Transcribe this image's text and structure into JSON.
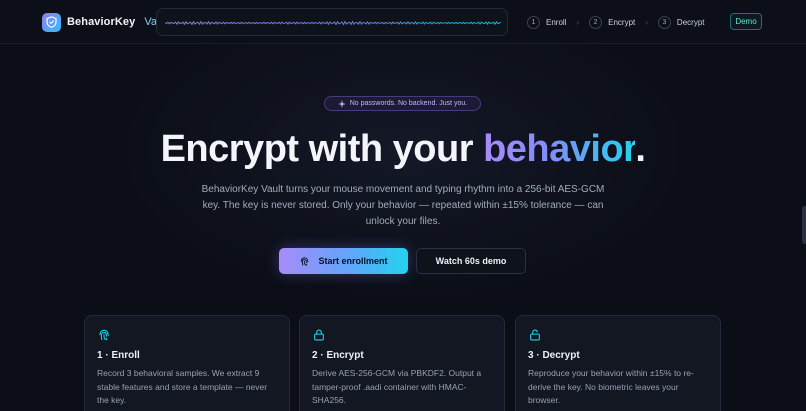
{
  "brand": {
    "name": "BehaviorKey",
    "accent": "Vault"
  },
  "steps": [
    {
      "num": "1",
      "label": "Enroll"
    },
    {
      "num": "2",
      "label": "Encrypt"
    },
    {
      "num": "3",
      "label": "Decrypt"
    }
  ],
  "step_separator": "›",
  "demo_badge": "Demo",
  "hero": {
    "pill": "No passwords. No backend. Just you.",
    "title_main": "Encrypt with your ",
    "title_accent": "behavior",
    "title_end": ".",
    "description": "BehaviorKey Vault turns your mouse movement and typing rhythm into a 256-bit AES-GCM key. The key is never stored. Only your behavior — repeated within ±15% tolerance — can unlock your files."
  },
  "buttons": {
    "primary": "Start enrollment",
    "secondary": "Watch 60s demo"
  },
  "cards": [
    {
      "icon": "fingerprint-icon",
      "title": "1 · Enroll",
      "desc": "Record 3 behavioral samples. We extract 9 stable features and store a template — never the key."
    },
    {
      "icon": "lock-icon",
      "title": "2 · Encrypt",
      "desc": "Derive AES-256-GCM via PBKDF2. Output a tamper-proof .aadi container with HMAC-SHA256."
    },
    {
      "icon": "unlock-icon",
      "title": "3 · Decrypt",
      "desc": "Reproduce your behavior within ±15% to re-derive the key. No biometric leaves your browser."
    }
  ],
  "colors": {
    "background": "#0b0e16",
    "accent_violet": "#a78bfa",
    "accent_cyan": "#22d3ee",
    "demo_teal": "#5eead4"
  }
}
